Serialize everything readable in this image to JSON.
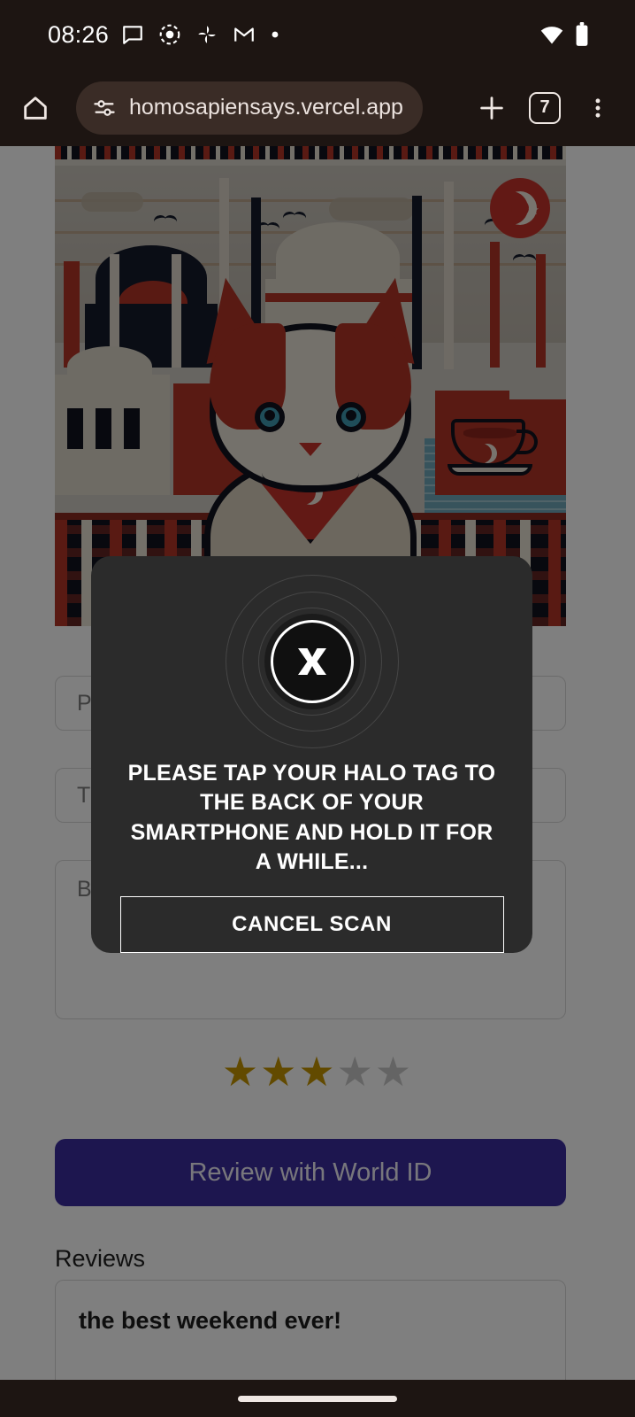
{
  "status_bar": {
    "time": "08:26",
    "icons": [
      "message-icon",
      "record-icon",
      "photos-pinwheel-icon",
      "gmail-icon",
      "dot-icon"
    ],
    "right_icons": [
      "wifi-icon",
      "battery-icon"
    ]
  },
  "browser": {
    "home_label": "Home",
    "url": "homosapiensays.vercel.app",
    "site_settings_icon": "tune-icon",
    "new_tab_label": "+",
    "tab_count": "7",
    "menu_label": "⋮"
  },
  "hero": {
    "alt": "Illustrated Istanbul cityscape with a cat wearing a Turkish flag bandana"
  },
  "form": {
    "place_placeholder": "Place name",
    "title_placeholder": "Title",
    "body_placeholder": "Body",
    "rating": 3,
    "rating_max": 5,
    "star_on_color": "#c49400",
    "star_off_color": "#c9c9c9",
    "submit_label": "Review with World ID",
    "submit_color": "#3b2d9e"
  },
  "reviews": {
    "section_label": "Reviews",
    "items": [
      {
        "text": "the best weekend ever!"
      }
    ]
  },
  "modal": {
    "logo_letter": "X",
    "message": "PLEASE TAP YOUR HALO TAG TO THE BACK OF YOUR SMARTPHONE AND HOLD IT FOR A WHILE...",
    "cancel_label": "CANCEL SCAN",
    "background_color": "#2b2b2b"
  },
  "nav_bar": {
    "gesture_pill": "home-gesture-pill"
  }
}
